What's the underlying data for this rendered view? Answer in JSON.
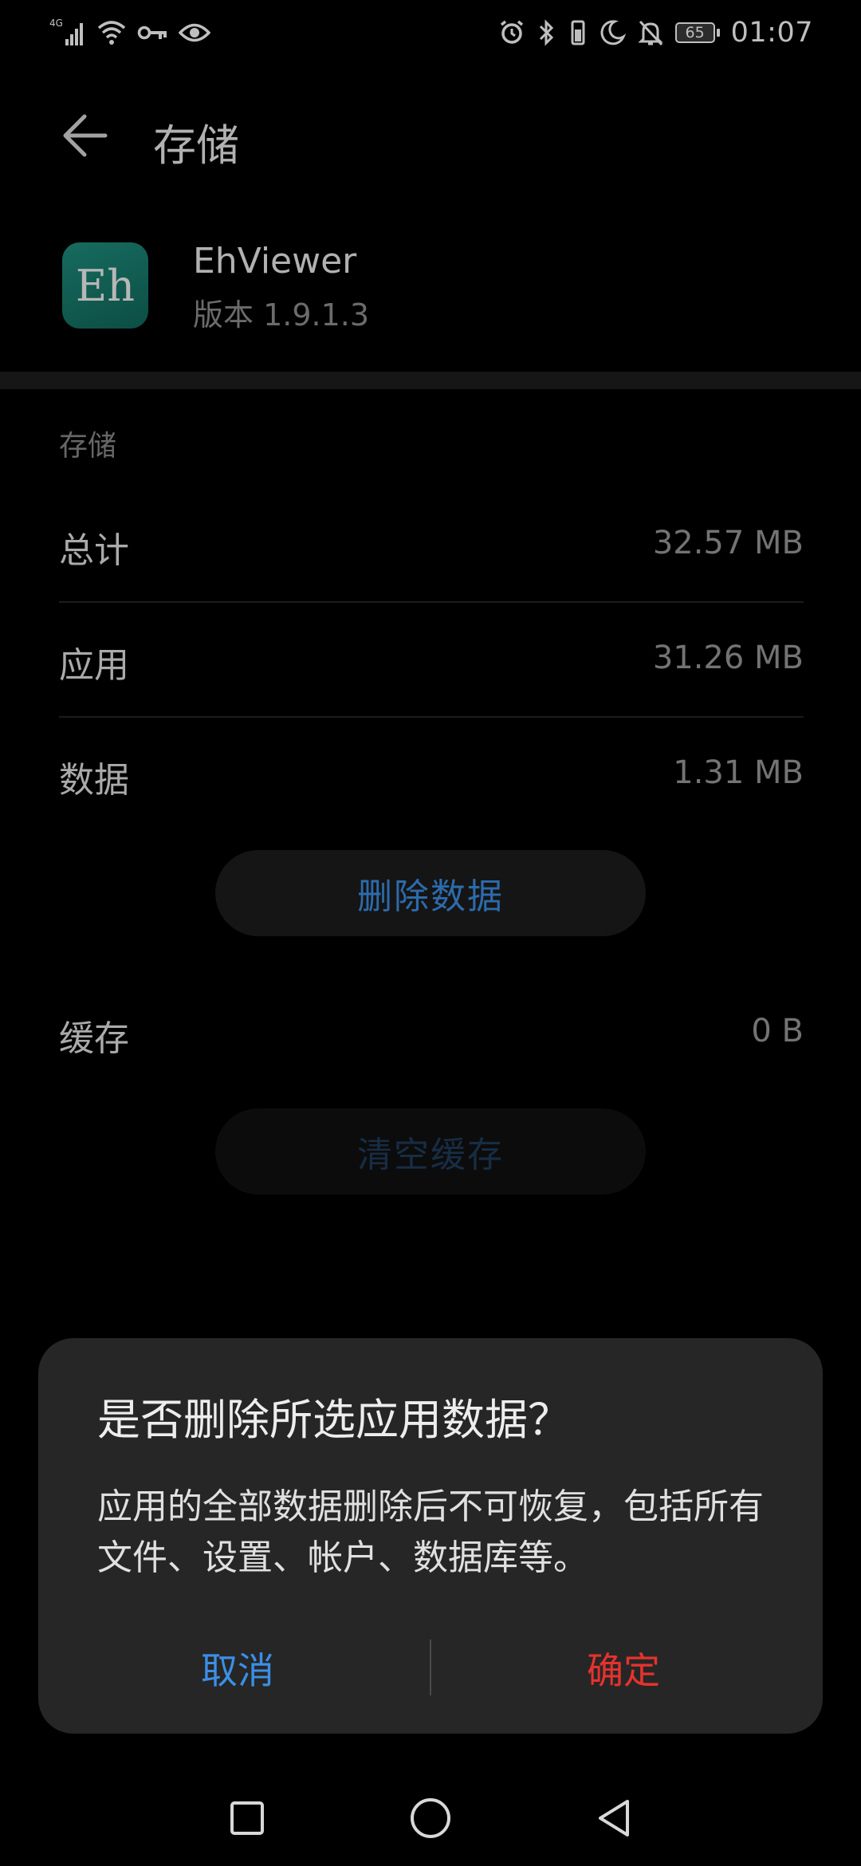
{
  "status_bar": {
    "network": "4G",
    "time": "01:07",
    "battery": "65",
    "icons_left": [
      "signal-icon",
      "wifi-icon",
      "key-icon",
      "eye-icon"
    ],
    "icons_right": [
      "alarm-icon",
      "bluetooth-icon",
      "vibrate-icon",
      "moon-icon",
      "bell-off-icon",
      "battery-icon"
    ]
  },
  "header": {
    "title": "存储",
    "back_icon": "back-arrow-icon"
  },
  "app": {
    "icon_text": "Eh",
    "icon_color": "#16796b",
    "name": "EhViewer",
    "version": "版本 1.9.1.3"
  },
  "storage": {
    "section_label": "存储",
    "rows": [
      {
        "label": "总计",
        "value": "32.57 MB"
      },
      {
        "label": "应用",
        "value": "31.26 MB"
      },
      {
        "label": "数据",
        "value": "1.31 MB"
      }
    ],
    "delete_data_button": "删除数据",
    "cache": {
      "label": "缓存",
      "value": "0 B"
    },
    "clear_cache_button": "清空缓存"
  },
  "dialog": {
    "title": "是否删除所选应用数据？",
    "message": "应用的全部数据删除后不可恢复，包括所有文件、设置、帐户、数据库等。",
    "cancel": "取消",
    "confirm": "确定",
    "cancel_color": "#3b8fe6",
    "confirm_color": "#e6322e"
  },
  "nav_bar": {
    "buttons": [
      "recents-square-icon",
      "home-circle-icon",
      "back-triangle-icon"
    ]
  }
}
